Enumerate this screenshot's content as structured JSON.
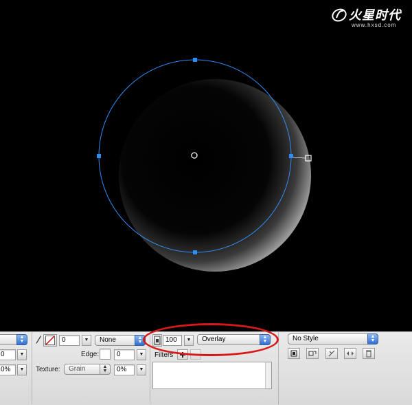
{
  "colors": {
    "canvas_bg": "#000000",
    "selection_path": "#2f8ef5",
    "annotation_ring": "#d61a1a",
    "panel_bg": "#e3e3e3",
    "popup_accent": "#2f6fd2"
  },
  "watermark": {
    "logo_text": "火星时代",
    "url": "www.hxsd.com"
  },
  "properties": {
    "left_clip": {
      "field1_value": "0",
      "field2_value": "0%"
    },
    "stroke": {
      "size_value": "0",
      "type_value": "None",
      "edge_label": "Edge:",
      "edge_value": "0",
      "texture_label": "Texture:",
      "texture_value": "Grain",
      "texture_amount": "0%"
    },
    "opacity_blend": {
      "opacity_value": "100",
      "blend_mode": "Overlay",
      "filters_label": "Filters"
    },
    "style": {
      "style_value": "No Style"
    }
  },
  "icons": [
    "pencil-icon",
    "stroke-color-icon",
    "opacity-icon",
    "add-filter-icon",
    "style-action-icons"
  ]
}
